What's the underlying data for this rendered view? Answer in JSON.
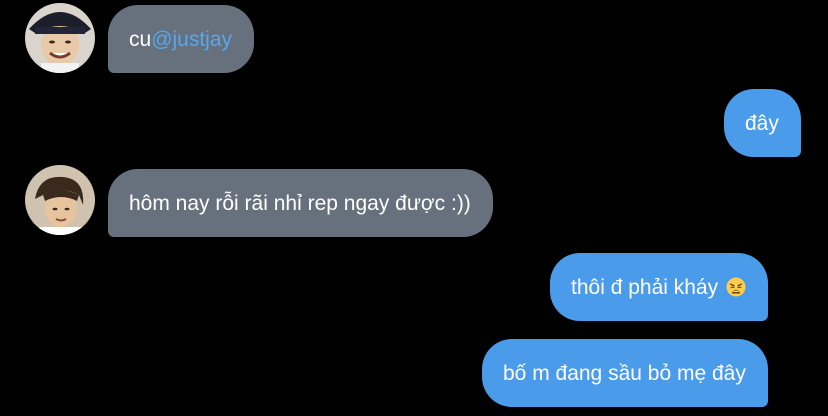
{
  "conversation": {
    "messages": [
      {
        "direction": "in",
        "text": "cu ",
        "mention": "@justjay"
      },
      {
        "direction": "out",
        "text": "đây"
      },
      {
        "direction": "in",
        "text": "hôm nay rỗi rãi nhỉ rep ngay được :))"
      },
      {
        "direction": "out",
        "text": "thôi đ phải kháy",
        "emoji": "weary-face-icon"
      },
      {
        "direction": "out",
        "text": "bố m đang sầu bỏ mẹ đây"
      }
    ]
  },
  "colors": {
    "background": "#000000",
    "incoming_bubble": "#66717d",
    "outgoing_bubble": "#4a9bea",
    "mention": "#58a6f0",
    "text": "#ffffff"
  }
}
